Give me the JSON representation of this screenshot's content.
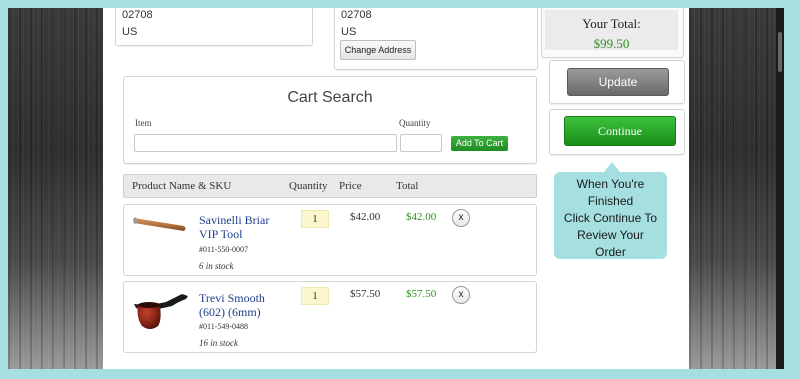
{
  "address_left": {
    "zip": "02708",
    "country": "US"
  },
  "address_right": {
    "zip": "02708",
    "country": "US",
    "change_label": "Change Address"
  },
  "cart_search": {
    "title": "Cart Search",
    "item_label": "Item",
    "quantity_label": "Quantity",
    "add_label": "Add To Cart"
  },
  "table": {
    "headers": {
      "product": "Product Name & SKU",
      "quantity": "Quantity",
      "price": "Price",
      "total": "Total"
    }
  },
  "items": [
    {
      "name_line1": "Savinelli Briar",
      "name_line2": "VIP Tool",
      "sku": "#011-550-0007",
      "stock": "6 in stock",
      "qty": "1",
      "price": "$42.00",
      "total": "$42.00",
      "remove": "x"
    },
    {
      "name_line1": "Trevi Smooth",
      "name_line2": "(602) (6mm)",
      "sku": "#011-549-0488",
      "stock": "16 in stock",
      "qty": "1",
      "price": "$57.50",
      "total": "$57.50",
      "remove": "x"
    }
  ],
  "summary": {
    "total_label": "Your Total:",
    "total_amount": "$99.50",
    "update_label": "Update",
    "continue_label": "Continue"
  },
  "tip": {
    "line1": "When You're",
    "line2": "Finished",
    "line3": "Click Continue To",
    "line4": "Review Your",
    "line5": "Order"
  },
  "colors": {
    "accent_green": "#2f8f1e",
    "frame": "#a6dfe0",
    "link_blue": "#1f3f8a"
  }
}
